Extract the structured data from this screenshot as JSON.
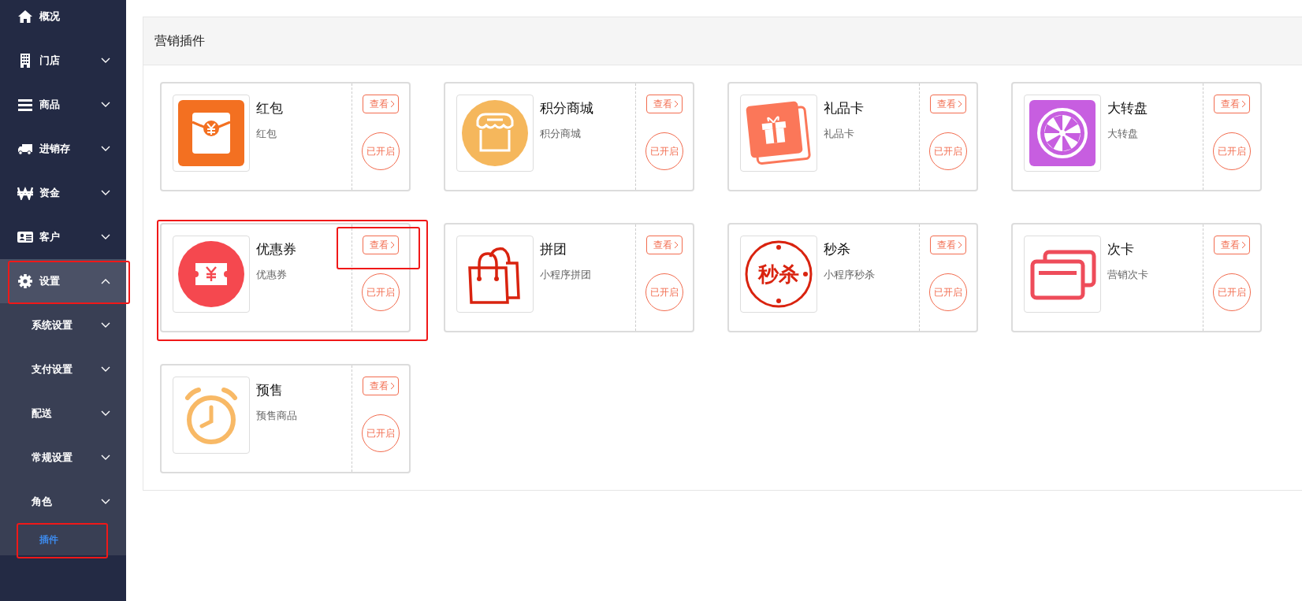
{
  "sidebar": {
    "items": [
      {
        "label": "概况"
      },
      {
        "label": "门店",
        "expanded": false
      },
      {
        "label": "商品",
        "expanded": false
      },
      {
        "label": "进销存",
        "expanded": false
      },
      {
        "label": "资金",
        "expanded": false
      },
      {
        "label": "客户",
        "expanded": false
      },
      {
        "label": "设置",
        "expanded": true,
        "highlighted": true,
        "children": [
          {
            "label": "系统设置",
            "expanded": false,
            "selected": false
          },
          {
            "label": "支付设置",
            "expanded": false,
            "selected": false
          },
          {
            "label": "配送",
            "expanded": false,
            "selected": false
          },
          {
            "label": "常规设置",
            "expanded": false,
            "selected": false
          },
          {
            "label": "角色",
            "expanded": false,
            "selected": false
          },
          {
            "label": "插件",
            "selected": true,
            "highlighted": true
          }
        ]
      }
    ]
  },
  "panel": {
    "title": "营销插件",
    "plugins": [
      {
        "title": "红包",
        "subtitle": "红包",
        "view": "查看",
        "status": "已开启",
        "highlighted": false,
        "view_highlighted": false
      },
      {
        "title": "积分商城",
        "subtitle": "积分商城",
        "view": "查看",
        "status": "已开启",
        "highlighted": false,
        "view_highlighted": false
      },
      {
        "title": "礼品卡",
        "subtitle": "礼品卡",
        "view": "查看",
        "status": "已开启",
        "highlighted": false,
        "view_highlighted": false
      },
      {
        "title": "大转盘",
        "subtitle": "大转盘",
        "view": "查看",
        "status": "已开启",
        "highlighted": false,
        "view_highlighted": false
      },
      {
        "title": "优惠券",
        "subtitle": "优惠券",
        "view": "查看",
        "status": "已开启",
        "highlighted": true,
        "view_highlighted": true
      },
      {
        "title": "拼团",
        "subtitle": "小程序拼团",
        "view": "查看",
        "status": "已开启",
        "highlighted": false,
        "view_highlighted": false
      },
      {
        "title": "秒杀",
        "subtitle": "小程序秒杀",
        "view": "查看",
        "status": "已开启",
        "highlighted": false,
        "view_highlighted": false,
        "logo_text": "秒杀"
      },
      {
        "title": "次卡",
        "subtitle": "营销次卡",
        "view": "查看",
        "status": "已开启",
        "highlighted": false,
        "view_highlighted": false
      },
      {
        "title": "预售",
        "subtitle": "预售商品",
        "view": "查看",
        "status": "已开启",
        "highlighted": false,
        "view_highlighted": false
      }
    ]
  }
}
